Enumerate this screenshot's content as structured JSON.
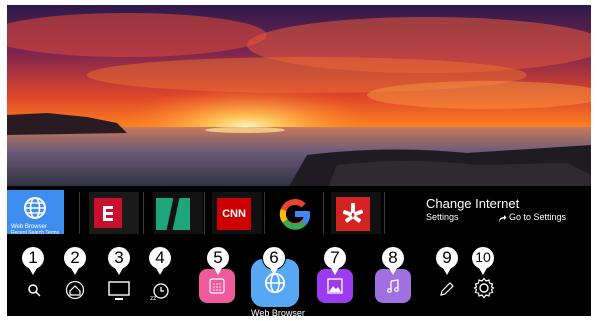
{
  "recent_tiles": [
    {
      "id": "web-browser",
      "title": "Web Browser",
      "subtitle": "Recent Search Terms",
      "color": "#3d8ef0"
    },
    {
      "id": "espn-app",
      "color": "#c8102e"
    },
    {
      "id": "green-app",
      "color": "#1fa57a"
    },
    {
      "id": "cnn-app",
      "label": "CNN",
      "color": "#cc0000"
    },
    {
      "id": "google-app",
      "label": "G",
      "color": "#000000"
    },
    {
      "id": "yelp-app",
      "color": "#d32323"
    }
  ],
  "settings_panel": {
    "title": "Change Internet",
    "subtitle": "Settings",
    "goto_label": "Go to Settings"
  },
  "bottom_bar": {
    "web_browser_label": "Web Browser"
  },
  "callouts": [
    "1",
    "2",
    "3",
    "4",
    "5",
    "6",
    "7",
    "8",
    "9",
    "10"
  ],
  "colors": {
    "selected": "#3d8ef0",
    "app_pink": "#ef5a9c",
    "app_web": "#56a8f5",
    "app_purple": "#9b3cf0",
    "app_music": "#a070e0"
  }
}
